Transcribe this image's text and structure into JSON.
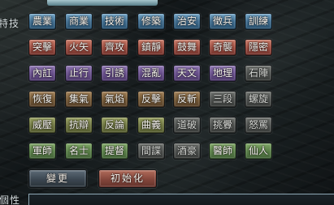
{
  "labels": {
    "top_left": "特技",
    "bottom_left": "個性"
  },
  "skills": [
    [
      "農業",
      "商業",
      "技術",
      "修築",
      "治安",
      "徵兵",
      "訓練"
    ],
    [
      "突擊",
      "火矢",
      "齊攻",
      "鎮靜",
      "鼓舞",
      "奇襲",
      "隱密"
    ],
    [
      "內訌",
      "止行",
      "引誘",
      "混亂",
      "天文",
      "地理",
      "石陣"
    ],
    [
      "恢復",
      "集氣",
      "氣焰",
      "反擊",
      "反斬",
      "三段",
      "螺旋"
    ],
    [
      "威壓",
      "抗辯",
      "反論",
      "曲義",
      "道破",
      "挑釁",
      "怒罵"
    ],
    [
      "軍師",
      "名士",
      "提督",
      "間諜",
      "酒豪",
      "醫師",
      "仙人"
    ]
  ],
  "actions": {
    "change": "變更",
    "reset": "初始化"
  },
  "colors": {
    "blue": "#3f6c8e",
    "red": "#9b4b3f",
    "purple": "#684f8b",
    "brown": "#725734",
    "gray": "#4c4f4d",
    "olive": "#6d7440",
    "green": "#587d46",
    "reset": "#83463b",
    "change": "#3b4650"
  }
}
